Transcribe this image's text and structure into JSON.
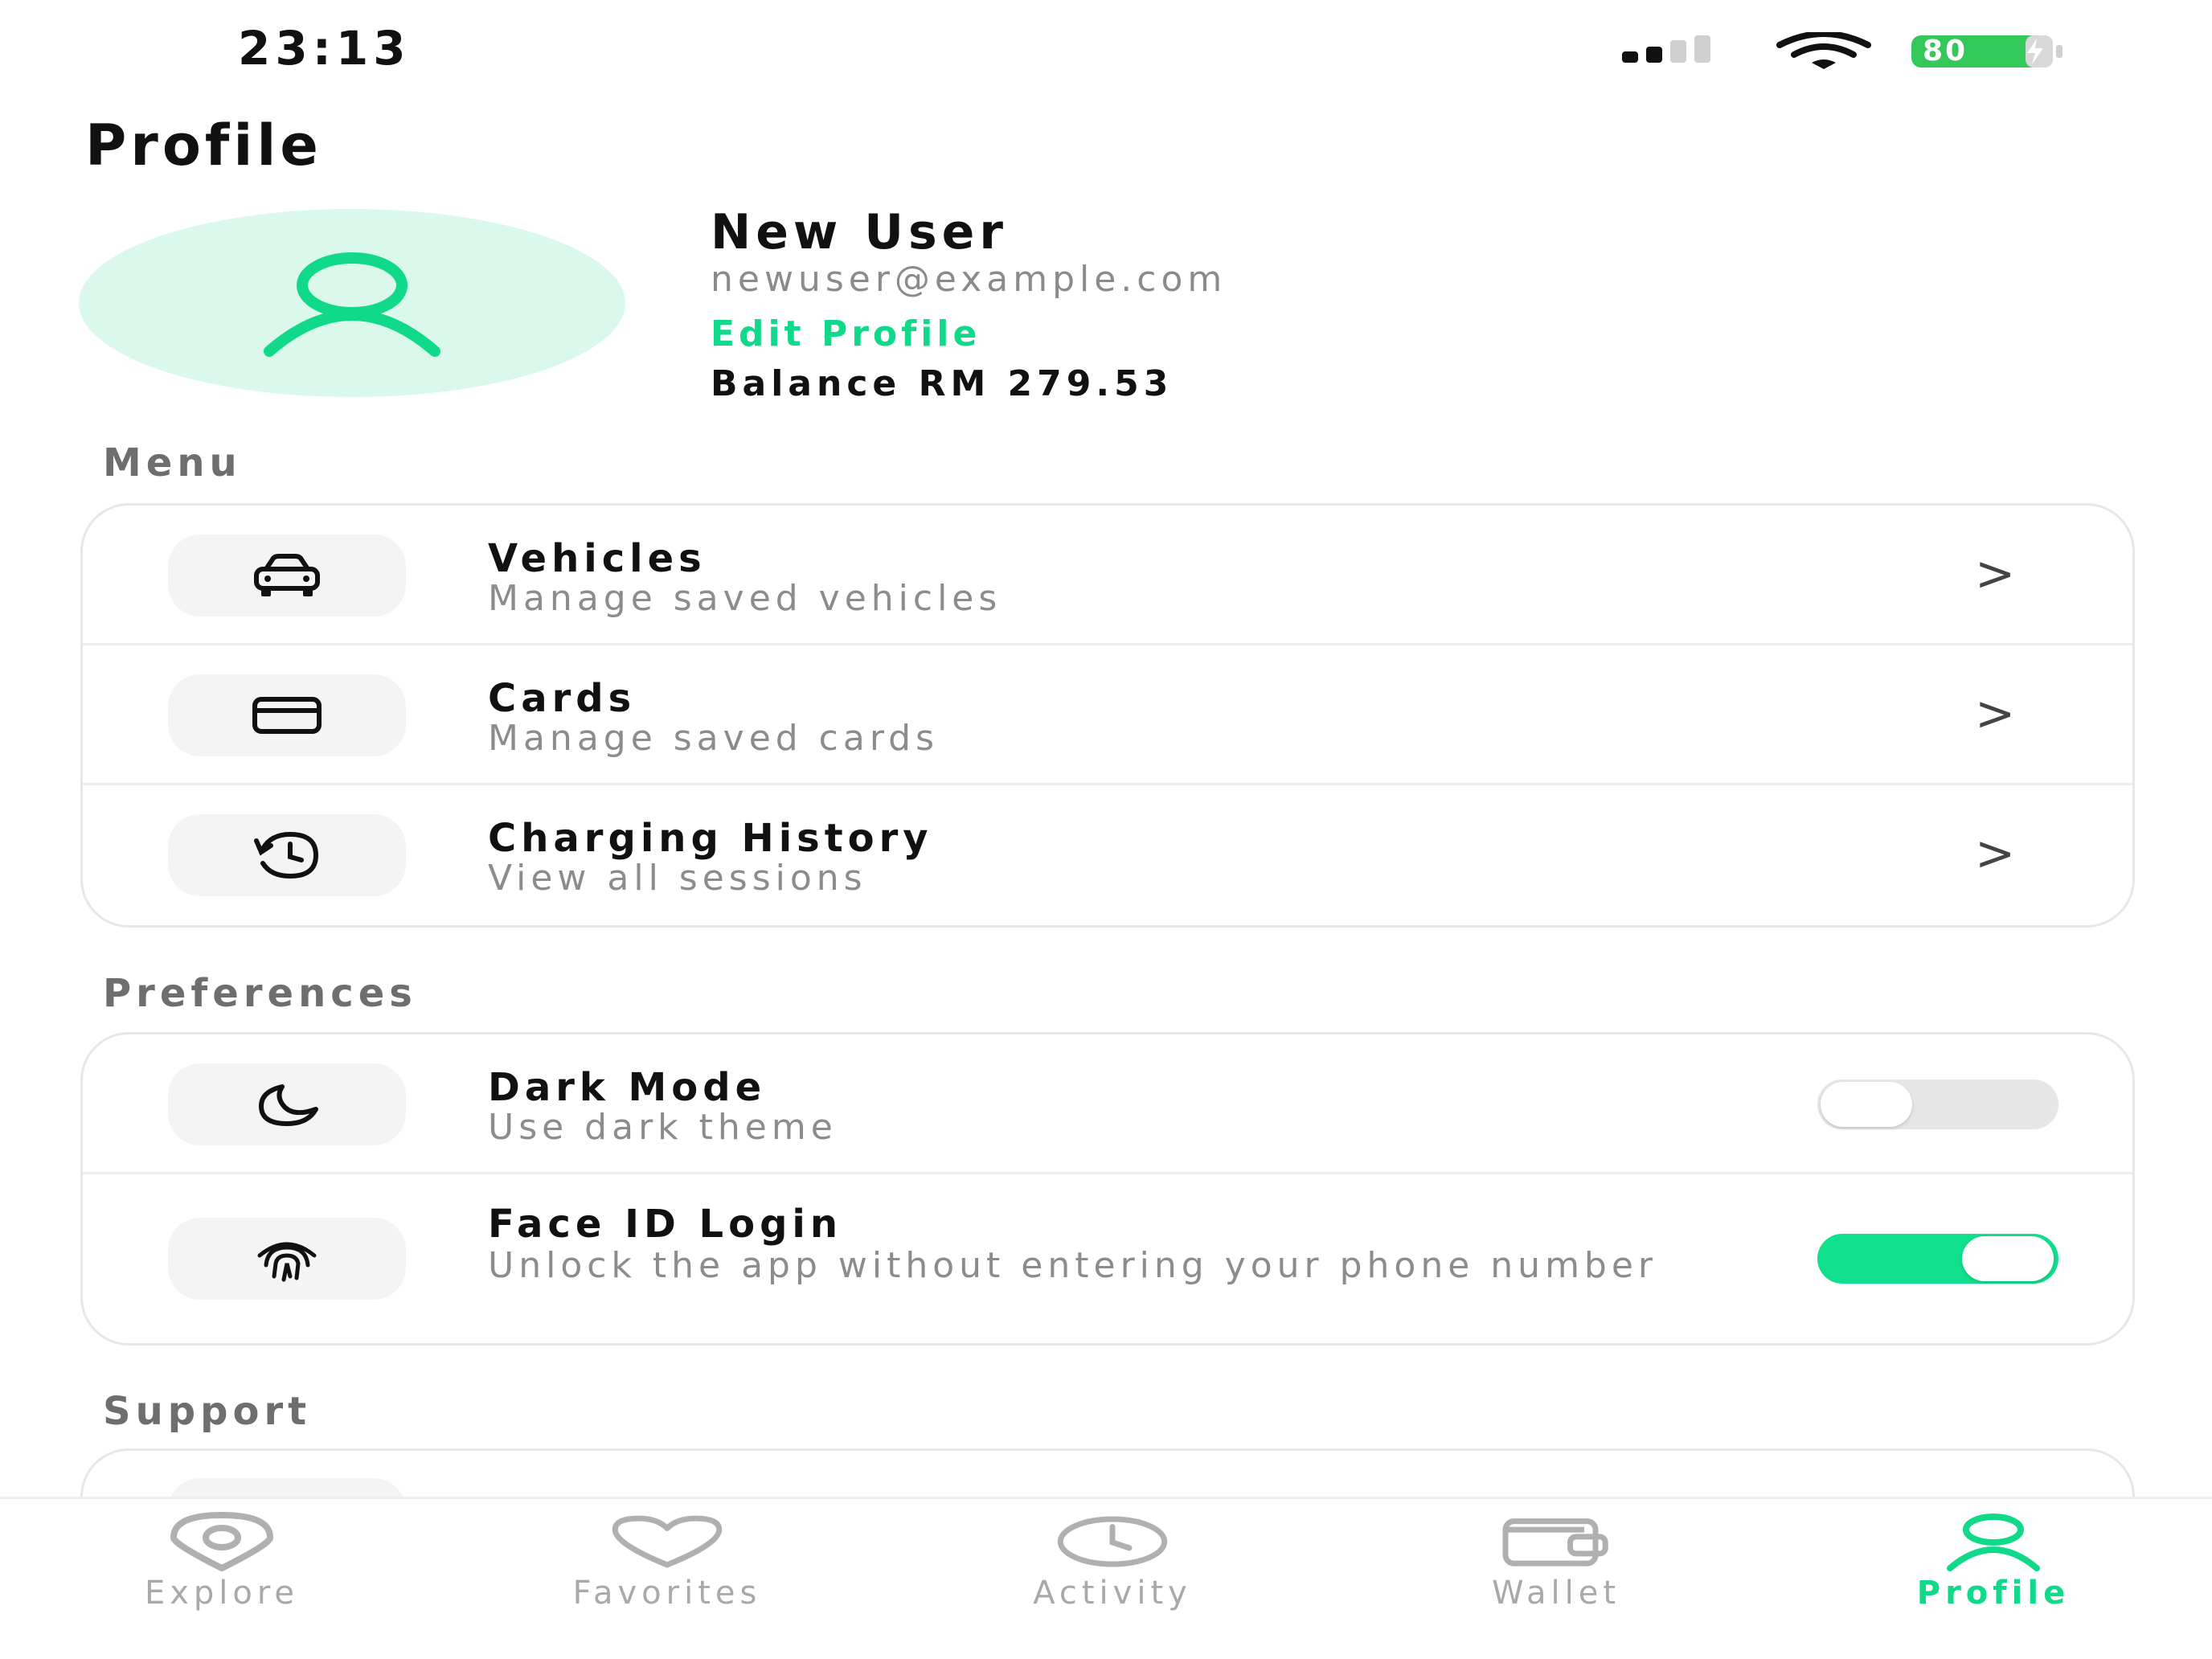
{
  "status_bar": {
    "time": "23:13",
    "battery_level": "80",
    "signal_icon": "signal-bars-icon",
    "wifi_icon": "wifi-icon"
  },
  "page": {
    "title": "Profile"
  },
  "profile": {
    "name": "New User",
    "email": "newuser@example.com",
    "edit_label": "Edit Profile",
    "balance": "Balance RM 279.53",
    "avatar_icon": "user-icon"
  },
  "menu": {
    "section_label": "Menu",
    "items": [
      {
        "title": "Vehicles",
        "subtitle": "Manage saved vehicles",
        "icon": "car-icon",
        "chevron": ">"
      },
      {
        "title": "Cards",
        "subtitle": "Manage saved cards",
        "icon": "credit-card-icon",
        "chevron": ">"
      },
      {
        "title": "Charging History",
        "subtitle": "View all sessions",
        "icon": "history-icon",
        "chevron": ">"
      }
    ]
  },
  "preferences": {
    "section_label": "Preferences",
    "items": [
      {
        "title": "Dark Mode",
        "subtitle": "Use dark theme",
        "icon": "moon-icon",
        "enabled": false
      },
      {
        "title": "Face ID Login",
        "subtitle": "Unlock the app without entering your phone number",
        "icon": "fingerprint-icon",
        "enabled": true
      }
    ]
  },
  "support": {
    "section_label": "Support"
  },
  "tabbar": {
    "tabs": [
      {
        "label": "Explore",
        "icon": "location-pin-icon",
        "active": false
      },
      {
        "label": "Favorites",
        "icon": "heart-icon",
        "active": false
      },
      {
        "label": "Activity",
        "icon": "clock-icon",
        "active": false
      },
      {
        "label": "Wallet",
        "icon": "wallet-icon",
        "active": false
      },
      {
        "label": "Profile",
        "icon": "user-icon",
        "active": true
      }
    ]
  },
  "colors": {
    "accent": "#10d98a",
    "avatar_bg": "#dbf8ed",
    "toggle_off": "#e6e6e6",
    "muted_text": "#8c8c8c",
    "battery": "#34c759"
  }
}
